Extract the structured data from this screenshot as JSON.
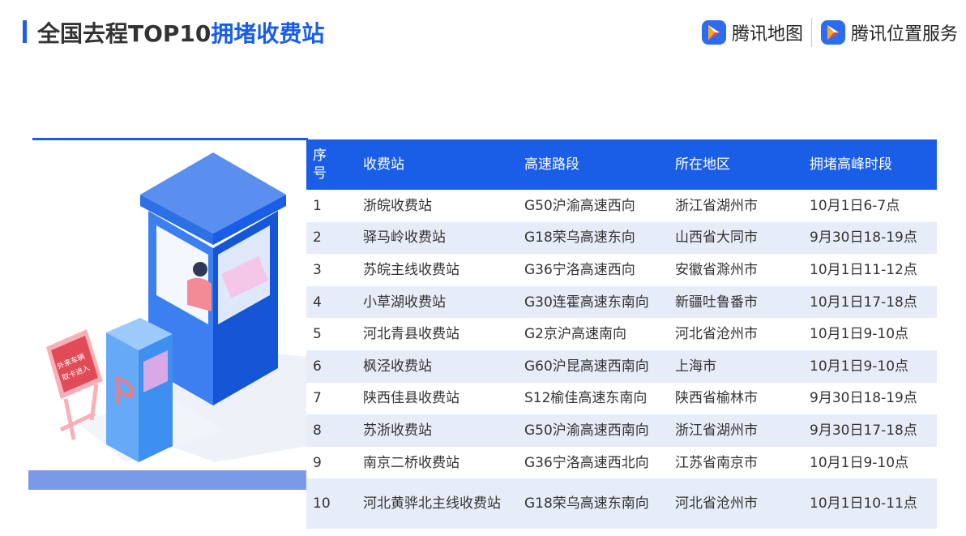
{
  "header": {
    "title_prefix": "全国去程TOP10",
    "title_highlight": "拥堵收费站"
  },
  "logos": [
    {
      "icon": "tencent-map-icon",
      "label": "腾讯地图"
    },
    {
      "icon": "tencent-location-icon",
      "label": "腾讯位置服务"
    }
  ],
  "illustration": {
    "sign_text_1": "外来车辆",
    "sign_text_2": "取卡进入",
    "machine_letter": "P"
  },
  "table": {
    "headers": [
      "序号",
      "收费站",
      "高速路段",
      "所在地区",
      "拥堵高峰时段"
    ],
    "rows": [
      [
        "1",
        "浙皖收费站",
        "G50沪渝高速西向",
        "浙江省湖州市",
        "10月1日6-7点"
      ],
      [
        "2",
        "驿马岭收费站",
        "G18荣乌高速东向",
        "山西省大同市",
        "9月30日18-19点"
      ],
      [
        "3",
        "苏皖主线收费站",
        "G36宁洛高速西向",
        "安徽省滁州市",
        "10月1日11-12点"
      ],
      [
        "4",
        "小草湖收费站",
        "G30连霍高速东南向",
        "新疆吐鲁番市",
        "10月1日17-18点"
      ],
      [
        "5",
        "河北青县收费站",
        "G2京沪高速南向",
        "河北省沧州市",
        "10月1日9-10点"
      ],
      [
        "6",
        "枫泾收费站",
        "G60沪昆高速西南向",
        "上海市",
        "10月1日9-10点"
      ],
      [
        "7",
        "陕西佳县收费站",
        "S12榆佳高速东南向",
        "陕西省榆林市",
        "9月30日18-19点"
      ],
      [
        "8",
        "苏浙收费站",
        "G50沪渝高速西南向",
        "浙江省湖州市",
        "9月30日17-18点"
      ],
      [
        "9",
        "南京二桥收费站",
        "G36宁洛高速西北向",
        "江苏省南京市",
        "10月1日9-10点"
      ],
      [
        "10",
        "河北黄骅北主线收费站",
        "G18荣乌高速东南向",
        "河北省沧州市",
        "10月1日10-11点"
      ]
    ]
  },
  "colors": {
    "accent": "#1a5ee8",
    "row_alt": "#e7ecf9"
  }
}
